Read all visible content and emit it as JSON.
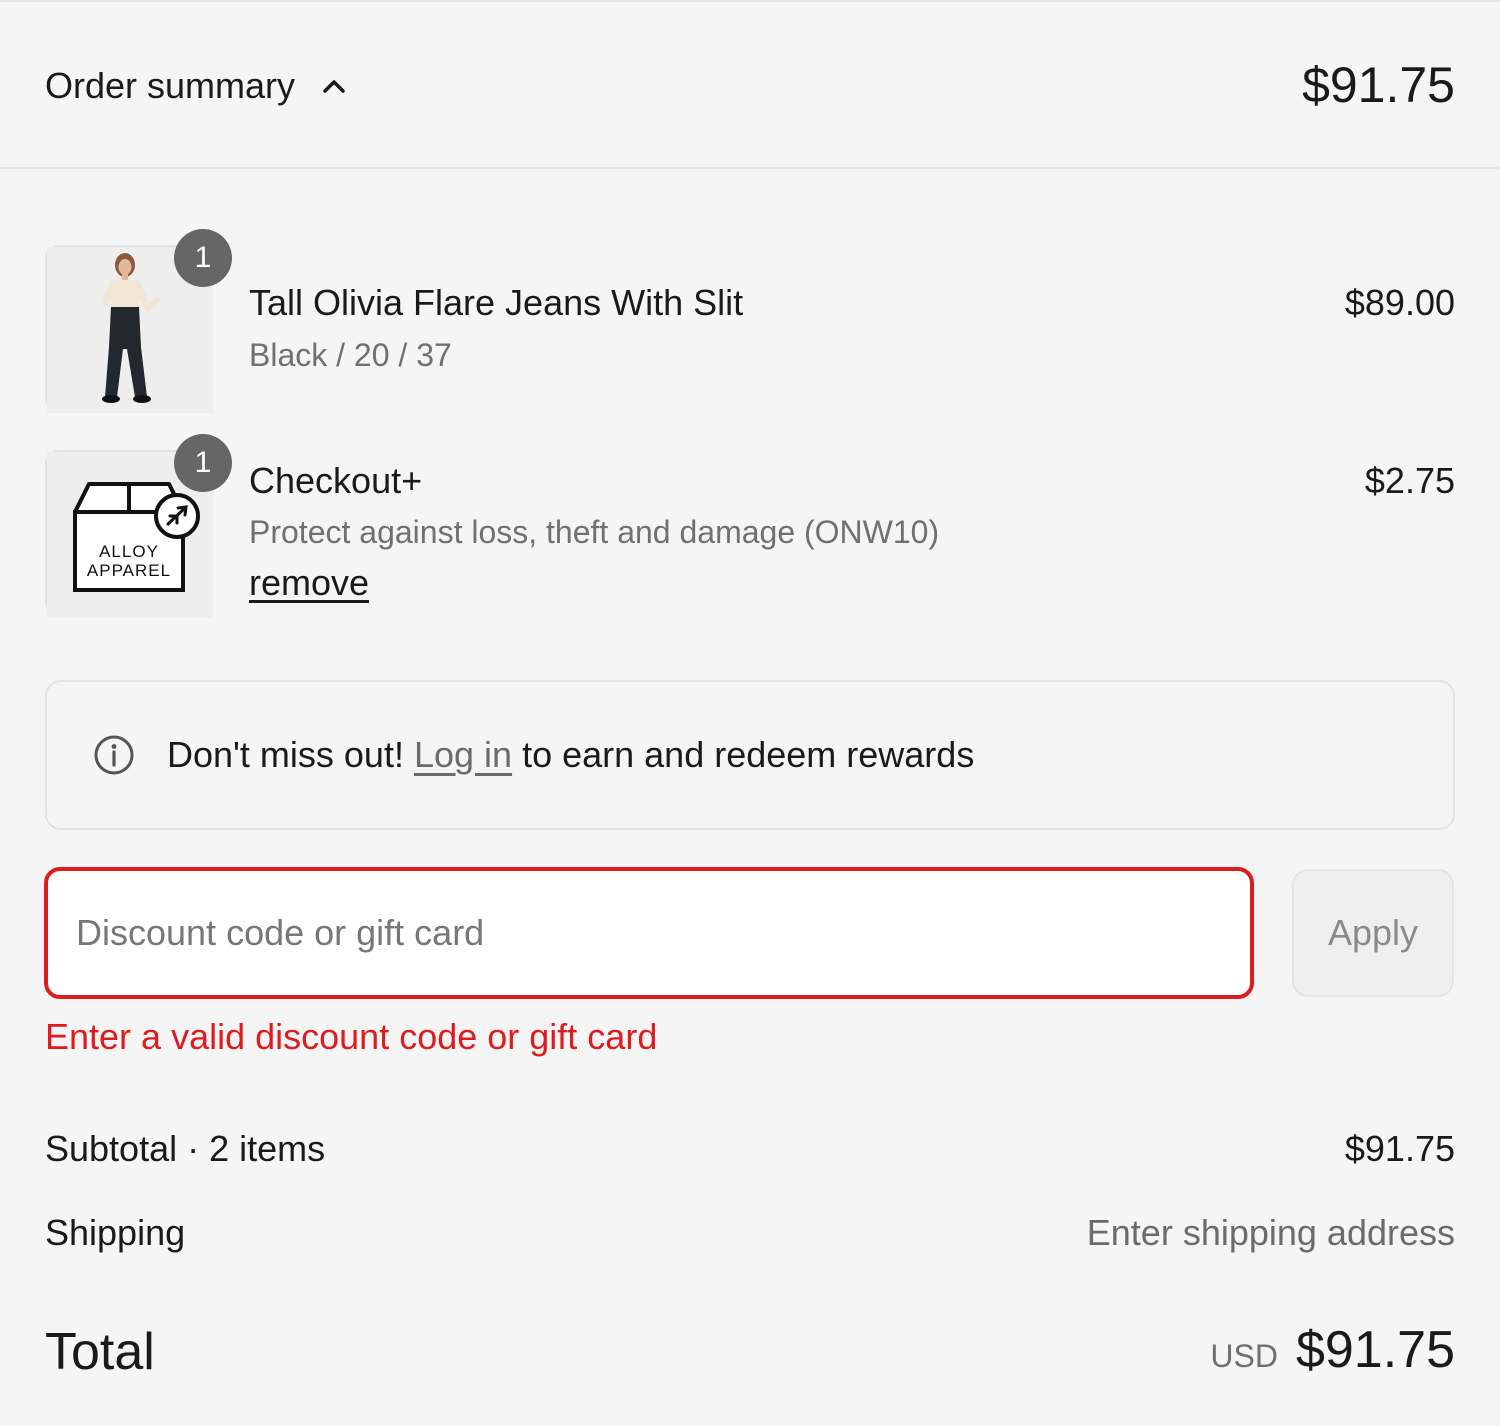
{
  "header": {
    "title": "Order summary",
    "total": "$91.75"
  },
  "items": [
    {
      "quantity": "1",
      "name": "Tall Olivia Flare Jeans With Slit",
      "variant": "Black / 20 / 37",
      "price": "$89.00",
      "image": "product-photo-model-in-jeans"
    },
    {
      "quantity": "1",
      "name": "Checkout+",
      "variant": "Protect against loss, theft and damage (ONW10)",
      "price": "$2.75",
      "remove_label": "remove",
      "logo_text": [
        "ALLOY",
        "APPAREL"
      ]
    }
  ],
  "rewards": {
    "prefix": "Don't miss out! ",
    "link": "Log in",
    "suffix": " to earn and redeem rewards"
  },
  "discount": {
    "placeholder": "Discount code or gift card",
    "value": "",
    "apply_label": "Apply",
    "error": "Enter a valid discount code or gift card"
  },
  "totals": {
    "subtotal_label": "Subtotal · 2 items",
    "subtotal_value": "$91.75",
    "shipping_label": "Shipping",
    "shipping_value": "Enter shipping address",
    "total_label": "Total",
    "currency": "USD",
    "total_value": "$91.75"
  },
  "colors": {
    "background": "#f5f5f5",
    "error": "#dd1d1d",
    "badge": "#666666",
    "muted_text": "#707070"
  }
}
